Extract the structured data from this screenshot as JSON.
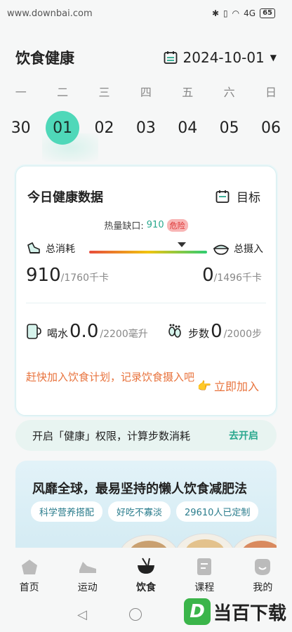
{
  "status": {
    "watermark": "www.downbai.com",
    "battery": "65",
    "signal": "4G"
  },
  "header": {
    "title": "饮食健康",
    "date": "2024-10-01"
  },
  "week": {
    "labels": [
      "一",
      "二",
      "三",
      "四",
      "五",
      "六",
      "日"
    ],
    "days": [
      "30",
      "01",
      "02",
      "03",
      "04",
      "05",
      "06"
    ],
    "selected_index": 1
  },
  "health_card": {
    "title": "今日健康数据",
    "goal_label": "目标",
    "deficit_label": "热量缺口:",
    "deficit_value": "910",
    "danger_label": "危险",
    "consume_label": "总消耗",
    "intake_label": "总摄入",
    "consume_value": "910",
    "consume_unit": "/1760千卡",
    "intake_value": "0",
    "intake_unit": "/1496千卡",
    "water_label": "喝水",
    "water_value": "0.0",
    "water_unit": "/2200毫升",
    "steps_label": "步数",
    "steps_value": "0",
    "steps_unit": "/2000步",
    "plan_text": "赶快加入饮食计划，记录饮食摄入吧",
    "join_label": "立即加入"
  },
  "health_permission": {
    "text": "开启「健康」权限，计算步数消耗",
    "link": "去开启"
  },
  "promo": {
    "title": "风靡全球，最易坚持的懒人饮食减肥法",
    "tags": [
      "科学营养搭配",
      "好吃不寡淡",
      "29610人已定制"
    ]
  },
  "tabbar": {
    "items": [
      {
        "label": "首页",
        "icon": "home-icon"
      },
      {
        "label": "运动",
        "icon": "sneaker-icon"
      },
      {
        "label": "饮食",
        "icon": "bowl-icon"
      },
      {
        "label": "课程",
        "icon": "course-icon"
      },
      {
        "label": "我的",
        "icon": "profile-icon"
      }
    ],
    "active_index": 2
  },
  "brand": {
    "logo_letter": "D",
    "logo_text": "当百下载"
  },
  "colors": {
    "accent": "#4fd8b9",
    "orange": "#e8733d",
    "teal_text": "#2aa88e",
    "danger": "#d33"
  }
}
